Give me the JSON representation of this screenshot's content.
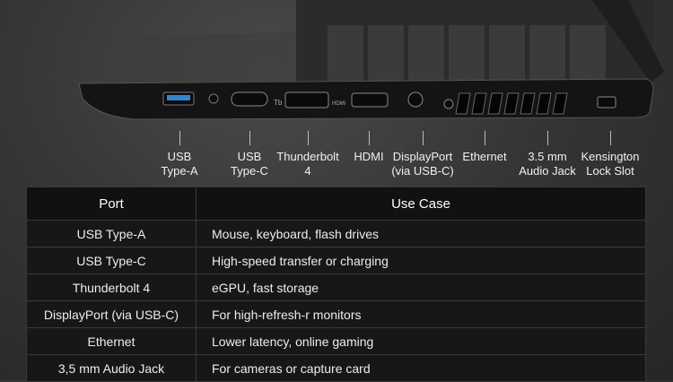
{
  "port_labels": [
    {
      "text": "USB\nType-A"
    },
    {
      "text": "USB\nType-C"
    },
    {
      "text": "Thunderbolt\n4"
    },
    {
      "text": "HDMI"
    },
    {
      "text": "DisplayPort\n(via USB-C)"
    },
    {
      "text": "Ethernet"
    },
    {
      "text": "3.5 mm\nAudio Jack"
    },
    {
      "text": "Kensington\nLock Slot"
    }
  ],
  "port_marks": {
    "tb": "Tb",
    "hdmi": "HDMI"
  },
  "table": {
    "headers": {
      "port": "Port",
      "use": "Use Case"
    },
    "rows": [
      {
        "port": "USB Type-A",
        "use": "Mouse, keyboard, flash drives"
      },
      {
        "port": "USB Type-C",
        "use": "High-speed transfer or charging"
      },
      {
        "port": "Thunderbolt 4",
        "use": "eGPU, fast storage"
      },
      {
        "port": "DisplayPort (via USB-C)",
        "use": "For high-refresh-r monitors"
      },
      {
        "port": "Ethernet",
        "use": "Lower latency, online gaming"
      },
      {
        "port": "3,5 mm Audio Jack",
        "use": "For cameras or capture card"
      }
    ]
  },
  "colors": {
    "usb_a_accent": "#2f86d8",
    "table_bg": "#171717",
    "header_bg": "#111111"
  }
}
